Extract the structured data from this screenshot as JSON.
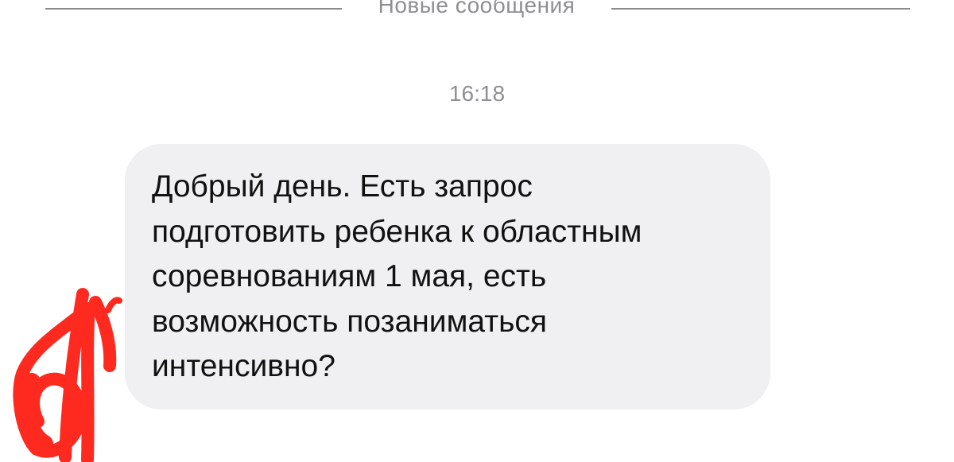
{
  "divider": {
    "label": "Новые сообщения"
  },
  "timestamp": "16:18",
  "message": {
    "text": "Добрый день. Есть запрос\nподготовить ребенка к областным\nсоревнованиям 1 мая, есть\nвозможность позаниматься\nинтенсивно?"
  },
  "colors": {
    "bubble_bg": "#f0f0f2",
    "secondary_text": "#8e8e93",
    "scribble": "#ff2a1f"
  },
  "icons": {
    "avatar": "redacted-avatar-scribble"
  }
}
